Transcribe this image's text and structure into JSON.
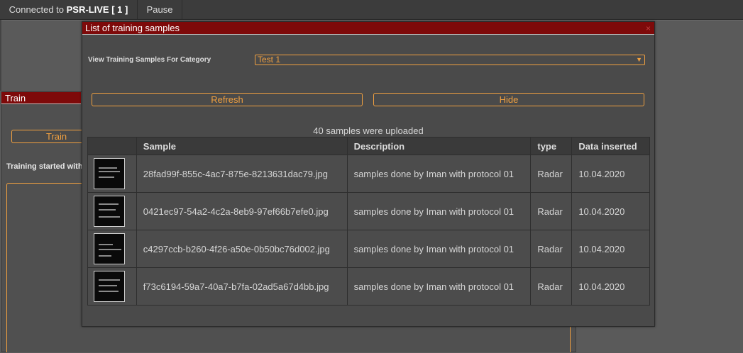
{
  "topbar": {
    "connected_prefix": "Connected to",
    "server": "PSR-LIVE [ 1 ]",
    "pause_label": "Pause"
  },
  "train_panel": {
    "title": "Train",
    "train_button": "Train",
    "status_text": "Training started with"
  },
  "modal": {
    "title": "List of training samples",
    "close_glyph": "×",
    "category_label": "View Training Samples For Category",
    "category_selected": "Test 1",
    "refresh_label": "Refresh",
    "hide_label": "Hide",
    "upload_status": "40 samples were uploaded",
    "columns": [
      "",
      "Sample",
      "Description",
      "type",
      "Data inserted"
    ],
    "rows": [
      {
        "sample": "28fad99f-855c-4ac7-875e-8213631dac79.jpg",
        "description": "samples done by Iman with protocol 01",
        "type": "Radar",
        "date": "10.04.2020"
      },
      {
        "sample": "0421ec97-54a2-4c2a-8eb9-97ef66b7efe0.jpg",
        "description": "samples done by Iman with protocol 01",
        "type": "Radar",
        "date": "10.04.2020"
      },
      {
        "sample": "c4297ccb-b260-4f26-a50e-0b50bc76d002.jpg",
        "description": "samples done by Iman with protocol 01",
        "type": "Radar",
        "date": "10.04.2020"
      },
      {
        "sample": "f73c6194-59a7-40a7-b7fa-02ad5a67d4bb.jpg",
        "description": "samples done by Iman with protocol 01",
        "type": "Radar",
        "date": "10.04.2020"
      }
    ]
  },
  "colors": {
    "accent": "#f0a040",
    "header_red": "#7e0a0a",
    "background": "#5a5a5a"
  }
}
